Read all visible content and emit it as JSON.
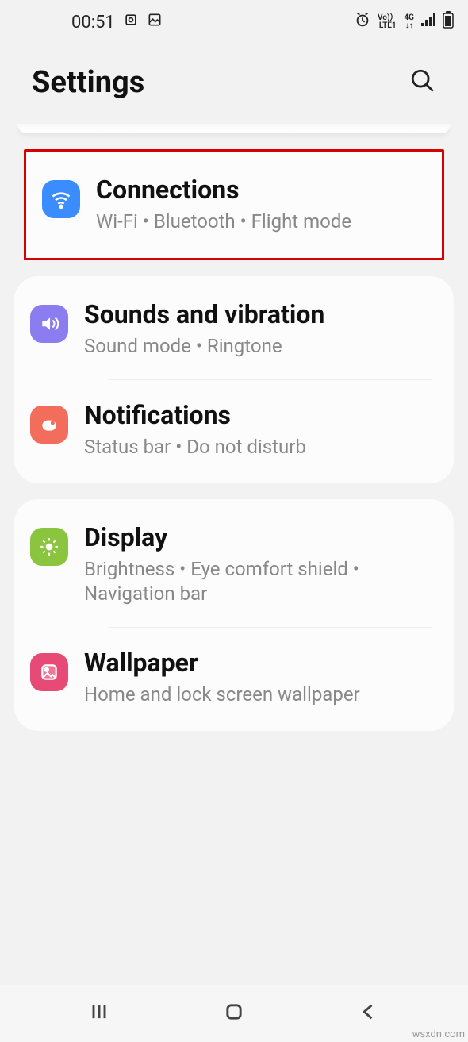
{
  "status": {
    "time": "00:51",
    "net_top": "Vo)）",
    "net_bot": "LTE1",
    "net2": "4G"
  },
  "header": {
    "title": "Settings"
  },
  "groups": [
    {
      "highlighted": true,
      "items": [
        {
          "key": "connections",
          "icon": "wifi",
          "color": "blue",
          "title": "Connections",
          "subtitle": "Wi‑Fi  •  Bluetooth  •  Flight mode"
        }
      ]
    },
    {
      "highlighted": false,
      "items": [
        {
          "key": "sounds",
          "icon": "volume",
          "color": "purple",
          "title": "Sounds and vibration",
          "subtitle": "Sound mode  •  Ringtone"
        },
        {
          "key": "notifications",
          "icon": "notif",
          "color": "coral",
          "title": "Notifications",
          "subtitle": "Status bar  •  Do not disturb"
        }
      ]
    },
    {
      "highlighted": false,
      "items": [
        {
          "key": "display",
          "icon": "sun",
          "color": "green",
          "title": "Display",
          "subtitle": "Brightness  •  Eye comfort shield  •  Navigation bar"
        },
        {
          "key": "wallpaper",
          "icon": "image",
          "color": "pink",
          "title": "Wallpaper",
          "subtitle": "Home and lock screen wallpaper"
        }
      ]
    }
  ],
  "watermark": "wsxdn.com"
}
